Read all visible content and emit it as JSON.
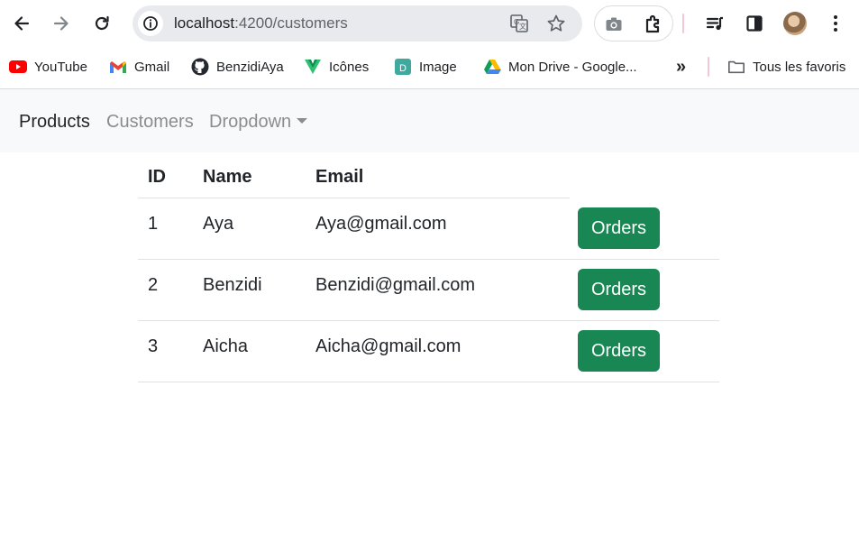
{
  "browser": {
    "url_host": "localhost",
    "url_path": ":4200/customers",
    "icons": [
      "back-icon",
      "forward-icon",
      "reload-icon",
      "site-info-icon",
      "translate-icon",
      "star-icon",
      "camera-icon",
      "extensions-icon",
      "media-icon",
      "side-panel-icon",
      "profile-avatar",
      "menu-icon"
    ]
  },
  "bookmarks": {
    "items": [
      {
        "label": "YouTube",
        "icon": "youtube-icon"
      },
      {
        "label": "Gmail",
        "icon": "gmail-icon"
      },
      {
        "label": "BenzidiAya",
        "icon": "github-icon"
      },
      {
        "label": "Icônes",
        "icon": "icones-icon"
      },
      {
        "label": "Image",
        "icon": "image-icon"
      },
      {
        "label": "Mon Drive - Google...",
        "icon": "google-drive-icon"
      }
    ],
    "overflow_label": "»",
    "all_bookmarks_label": "Tous les favoris"
  },
  "navbar": {
    "brand": "Products",
    "links": [
      "Customers",
      "Dropdown"
    ]
  },
  "table": {
    "headers": [
      "ID",
      "Name",
      "Email"
    ],
    "rows": [
      {
        "id": "1",
        "name": "Aya",
        "email": "Aya@gmail.com",
        "action": "Orders"
      },
      {
        "id": "2",
        "name": "Benzidi",
        "email": "Benzidi@gmail.com",
        "action": "Orders"
      },
      {
        "id": "3",
        "name": "Aicha",
        "email": "Aicha@gmail.com",
        "action": "Orders"
      }
    ]
  },
  "colors": {
    "button_success": "#198754",
    "navbar_bg": "#f8f9fa",
    "muted_link": "#8a8d90"
  }
}
